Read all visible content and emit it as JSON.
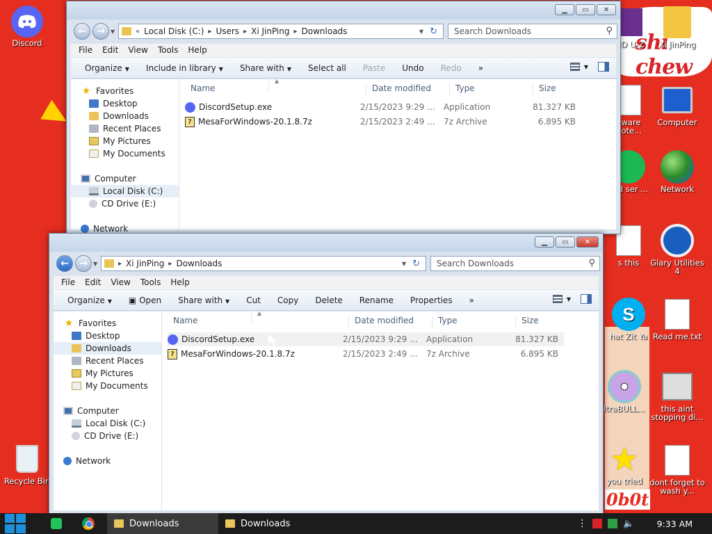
{
  "desktop": {
    "icons_left": [
      {
        "label": "Discord",
        "icon": "discord-icon"
      },
      {
        "label": "Recycle Bin",
        "icon": "recycle-bin-icon"
      }
    ],
    "icons_right": [
      {
        "label": "Xi JinPing",
        "icon": "user-folder-icon"
      },
      {
        "label": "Computer",
        "icon": "computer-icon"
      },
      {
        "label": "Network",
        "icon": "network-icon"
      },
      {
        "label": "Glary Utilities 4",
        "icon": "glary-icon"
      },
      {
        "label": "Read me.txt",
        "icon": "text-file-icon"
      },
      {
        "label": "this aint stopping di...",
        "icon": "troubleshoot-icon"
      },
      {
        "label": "dont forget to wash y...",
        "icon": "text-file-icon"
      }
    ],
    "icons_partial": [
      {
        "label": "UID U-Z",
        "icon": "cpuz-icon"
      },
      {
        "label": "eware Note...",
        "icon": "note-icon"
      },
      {
        "label": "sed ser ...",
        "icon": "spotify-icon"
      },
      {
        "label": "s this",
        "icon": "doc-icon"
      },
      {
        "label": "hat Zit Ya",
        "icon": "skype-icon"
      },
      {
        "label": "ltraBULL...",
        "icon": "cd-icon"
      },
      {
        "label": "you tried",
        "icon": "star-icon"
      }
    ],
    "wallpaper_text": [
      "shi chew",
      "0b0t"
    ]
  },
  "window_back": {
    "breadcrumb": [
      "Local Disk (C:)",
      "Users",
      "Xi JinPing",
      "Downloads"
    ],
    "breadcrumb_prefix": "«",
    "search_placeholder": "Search Downloads",
    "menu": [
      "File",
      "Edit",
      "View",
      "Tools",
      "Help"
    ],
    "commands": [
      {
        "label": "Organize",
        "dropdown": true,
        "disabled": false
      },
      {
        "label": "Include in library",
        "dropdown": true,
        "disabled": false
      },
      {
        "label": "Share with",
        "dropdown": true,
        "disabled": false
      },
      {
        "label": "Select all",
        "dropdown": false,
        "disabled": false
      },
      {
        "label": "Paste",
        "dropdown": false,
        "disabled": true
      },
      {
        "label": "Undo",
        "dropdown": false,
        "disabled": false
      },
      {
        "label": "Redo",
        "dropdown": false,
        "disabled": true
      },
      {
        "label": "»",
        "dropdown": false,
        "disabled": false
      }
    ],
    "nav": [
      {
        "label": "Favorites",
        "icon": "star",
        "head": true
      },
      {
        "label": "Desktop",
        "icon": "desk"
      },
      {
        "label": "Downloads",
        "icon": "fold"
      },
      {
        "label": "Recent Places",
        "icon": "rec"
      },
      {
        "label": "My Pictures",
        "icon": "pic"
      },
      {
        "label": "My Documents",
        "icon": "doc"
      },
      {
        "gap": true
      },
      {
        "label": "Computer",
        "icon": "comp",
        "head": true
      },
      {
        "label": "Local Disk (C:)",
        "icon": "disk",
        "selected": true
      },
      {
        "label": "CD Drive (E:)",
        "icon": "cd"
      },
      {
        "gap": true
      },
      {
        "label": "Network",
        "icon": "net",
        "head": true
      }
    ],
    "columns": [
      "Name",
      "Date modified",
      "Type",
      "Size"
    ],
    "files": [
      {
        "name": "DiscordSetup.exe",
        "date": "2/15/2023 9:29 ...",
        "type": "Application",
        "size": "81.327 KB",
        "icon": "disc"
      },
      {
        "name": "MesaForWindows-20.1.8.7z",
        "date": "2/15/2023 2:49 ...",
        "type": "7z Archive",
        "size": "6.895 KB",
        "icon": "7z"
      }
    ]
  },
  "window_front": {
    "breadcrumb": [
      "Xi JinPing",
      "Downloads"
    ],
    "search_placeholder": "Search Downloads",
    "menu": [
      "File",
      "Edit",
      "View",
      "Tools",
      "Help"
    ],
    "commands": [
      {
        "label": "Organize",
        "dropdown": true,
        "disabled": false
      },
      {
        "label": "Open",
        "dropdown": false,
        "disabled": false,
        "icon": true
      },
      {
        "label": "Share with",
        "dropdown": true,
        "disabled": false
      },
      {
        "label": "Cut",
        "dropdown": false,
        "disabled": false
      },
      {
        "label": "Copy",
        "dropdown": false,
        "disabled": false
      },
      {
        "label": "Delete",
        "dropdown": false,
        "disabled": false
      },
      {
        "label": "Rename",
        "dropdown": false,
        "disabled": false
      },
      {
        "label": "Properties",
        "dropdown": false,
        "disabled": false
      },
      {
        "label": "»",
        "dropdown": false,
        "disabled": false
      }
    ],
    "nav": [
      {
        "label": "Favorites",
        "icon": "star",
        "head": true
      },
      {
        "label": "Desktop",
        "icon": "desk"
      },
      {
        "label": "Downloads",
        "icon": "fold",
        "selected": true
      },
      {
        "label": "Recent Places",
        "icon": "rec"
      },
      {
        "label": "My Pictures",
        "icon": "pic"
      },
      {
        "label": "My Documents",
        "icon": "doc"
      },
      {
        "gap": true
      },
      {
        "label": "Computer",
        "icon": "comp",
        "head": true
      },
      {
        "label": "Local Disk (C:)",
        "icon": "disk"
      },
      {
        "label": "CD Drive (E:)",
        "icon": "cd"
      },
      {
        "gap": true
      },
      {
        "label": "Network",
        "icon": "net",
        "head": true
      }
    ],
    "columns": [
      "Name",
      "Date modified",
      "Type",
      "Size"
    ],
    "files": [
      {
        "name": "DiscordSetup.exe",
        "date": "2/15/2023 9:29 ...",
        "type": "Application",
        "size": "81.327 KB",
        "icon": "disc",
        "hover": true
      },
      {
        "name": "MesaForWindows-20.1.8.7z",
        "date": "2/15/2023 2:49 ...",
        "type": "7z Archive",
        "size": "6.895 KB",
        "icon": "7z"
      }
    ]
  },
  "taskbar": {
    "pinned": [
      "spotify-icon",
      "chrome-icon"
    ],
    "tasks": [
      {
        "label": "Downloads",
        "active": true
      },
      {
        "label": "Downloads",
        "active": false
      }
    ],
    "tray_icons": [
      "overflow-icon",
      "flag-icon",
      "network-tray-icon",
      "volume-icon"
    ],
    "clock": "9:33 AM"
  }
}
